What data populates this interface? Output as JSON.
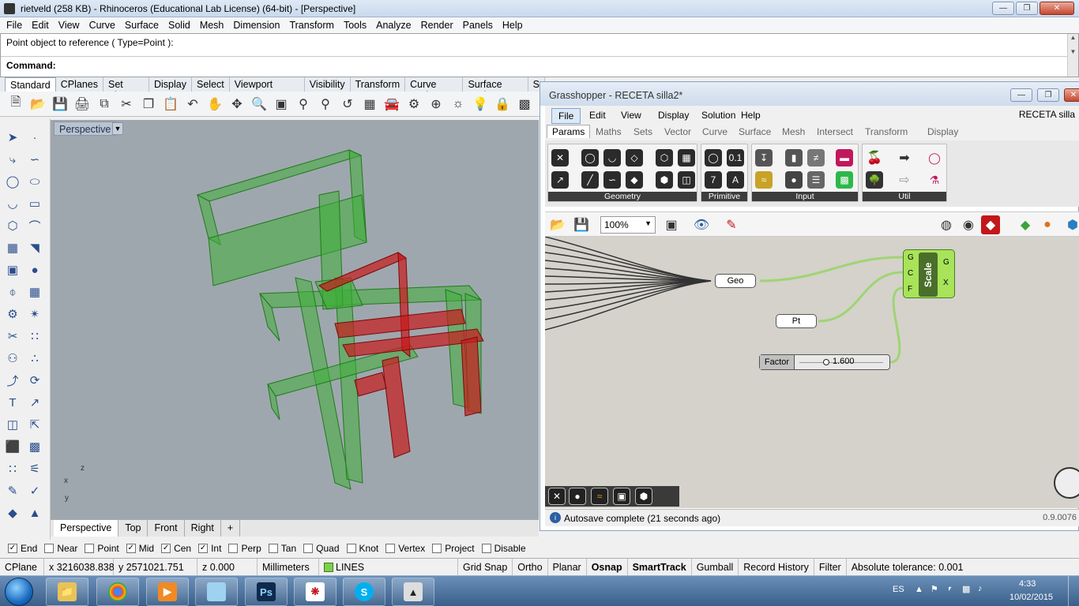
{
  "rhino": {
    "title": "rietveld (258 KB) - Rhinoceros (Educational Lab License) (64-bit) - [Perspective]",
    "menu": [
      "File",
      "Edit",
      "View",
      "Curve",
      "Surface",
      "Solid",
      "Mesh",
      "Dimension",
      "Transform",
      "Tools",
      "Analyze",
      "Render",
      "Panels",
      "Help"
    ],
    "prompt_line": "Point object to reference ( Type=Point ):",
    "command_label": "Command:",
    "toolbar_tabs": [
      "Standard",
      "CPlanes",
      "Set View",
      "Display",
      "Select",
      "Viewport Layout",
      "Visibility",
      "Transform",
      "Curve Tools",
      "Surface Tools",
      "S"
    ],
    "viewport_name": "Perspective",
    "viewport_tabs": [
      "Perspective",
      "Top",
      "Front",
      "Right",
      "+"
    ],
    "axes": {
      "z": "z",
      "x": "x",
      "y": "y"
    },
    "osnaps": [
      {
        "label": "End",
        "checked": true
      },
      {
        "label": "Near",
        "checked": false
      },
      {
        "label": "Point",
        "checked": false
      },
      {
        "label": "Mid",
        "checked": true
      },
      {
        "label": "Cen",
        "checked": true
      },
      {
        "label": "Int",
        "checked": true
      },
      {
        "label": "Perp",
        "checked": false
      },
      {
        "label": "Tan",
        "checked": false
      },
      {
        "label": "Quad",
        "checked": false
      },
      {
        "label": "Knot",
        "checked": false
      },
      {
        "label": "Vertex",
        "checked": false
      },
      {
        "label": "Project",
        "checked": false
      },
      {
        "label": "Disable",
        "checked": false
      }
    ],
    "status": {
      "cplane": "CPlane",
      "x": "x 3216038.838",
      "y": "y 2571021.751",
      "z": "z 0.000",
      "units": "Millimeters",
      "layer": "LINES",
      "layer_color": "#7cd14a",
      "toggles": [
        "Grid Snap",
        "Ortho",
        "Planar",
        "Osnap",
        "SmartTrack",
        "Gumball",
        "Record History",
        "Filter"
      ],
      "bold_toggles": [
        "Osnap",
        "SmartTrack"
      ],
      "tolerance": "Absolute tolerance: 0.001"
    }
  },
  "grasshopper": {
    "title": "Grasshopper - RECETA silla2*",
    "menu": [
      "File",
      "Edit",
      "View",
      "Display",
      "Solution",
      "Help"
    ],
    "doc_name": "RECETA silla",
    "tabs": [
      "Params",
      "Maths",
      "Sets",
      "Vector",
      "Curve",
      "Surface",
      "Mesh",
      "Intersect",
      "Transform",
      "Display"
    ],
    "ribbon_groups": [
      "Geometry",
      "Primitive",
      "Input",
      "Util"
    ],
    "zoom": "100%",
    "nodes": {
      "geo": "Geo",
      "pt": "Pt",
      "scale_title": "Scale",
      "scale_inputs": [
        "G",
        "C",
        "F"
      ],
      "scale_outputs": [
        "G",
        "X"
      ],
      "slider_label": "Factor",
      "slider_value": "1.600"
    },
    "status": "Autosave complete (21 seconds ago)",
    "version": "0.9.0076"
  },
  "taskbar": {
    "lang": "ES",
    "time": "4:33",
    "date": "10/02/2015",
    "apps": [
      "explorer",
      "chrome",
      "media-player",
      "notes",
      "photoshop",
      "acrobat",
      "skype",
      "rhino"
    ]
  },
  "colors": {
    "chair_green": "#3fae3a",
    "chair_red": "#c8191b",
    "viewport_bg": "#9fa7ae",
    "gh_canvas": "#d4d2cb",
    "gh_component": "#a8e35a"
  }
}
